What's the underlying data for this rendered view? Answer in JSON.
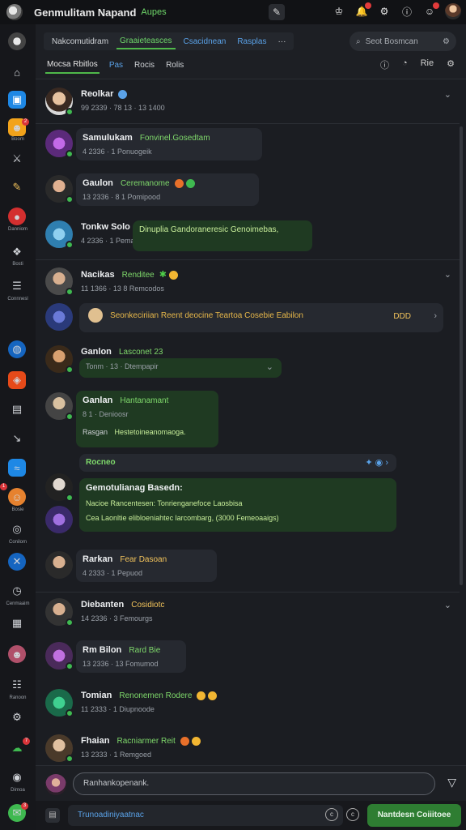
{
  "topbar": {
    "title": "Genmulitam Napand",
    "subtitle": "Aupes",
    "mid_icon": "pin-icon",
    "right_icons": [
      "bell-icon",
      "mention-icon",
      "settings-icon",
      "help-icon",
      "user-icon"
    ]
  },
  "rail": {
    "items": [
      {
        "icon": "home-icon",
        "label": ""
      },
      {
        "icon": "bookmark-icon",
        "label": ""
      },
      {
        "icon": "box-icon",
        "label": "Boom"
      },
      {
        "icon": "swords-icon",
        "label": ""
      },
      {
        "icon": "pen-icon",
        "label": ""
      },
      {
        "icon": "record-icon",
        "label": "Danniom"
      },
      {
        "icon": "cube-icon",
        "label": "Bosti"
      },
      {
        "icon": "stack-icon",
        "label": "Connnesl"
      },
      {
        "icon": "globe-icon",
        "label": ""
      },
      {
        "icon": "app-icon",
        "label": ""
      },
      {
        "icon": "tablet-icon",
        "label": ""
      },
      {
        "icon": "arrow-icon",
        "label": ""
      },
      {
        "icon": "chart-icon",
        "label": ""
      },
      {
        "icon": "face-icon",
        "label": "Bosie"
      },
      {
        "icon": "camera-icon",
        "label": "Conilom"
      },
      {
        "icon": "close-circle-icon",
        "label": ""
      },
      {
        "icon": "clock-icon",
        "label": "Cenmaaim"
      },
      {
        "icon": "frame-icon",
        "label": ""
      },
      {
        "icon": "robot-icon",
        "label": ""
      },
      {
        "icon": "list-icon",
        "label": "Ranoon"
      },
      {
        "icon": "gear-icon",
        "label": ""
      },
      {
        "icon": "cloud-icon",
        "label": ""
      },
      {
        "icon": "disc-icon",
        "label": "Dirnoa"
      },
      {
        "icon": "chat-icon",
        "label": ""
      }
    ]
  },
  "header": {
    "tabs": [
      {
        "label": "Nakcomutidram"
      },
      {
        "label": "Graaieteasces"
      },
      {
        "label": "Csacidnean"
      },
      {
        "label": "Rasplas"
      }
    ],
    "more": "···",
    "search_placeholder": "Seot Bosmcan",
    "subtabs": [
      {
        "label": "Mocsa Rbitlos"
      },
      {
        "label": "Pas"
      },
      {
        "label": "Rocis"
      },
      {
        "label": "Rolis"
      }
    ],
    "right_labels": [
      "ⓘ",
      "◔",
      "Rie",
      "⚙"
    ]
  },
  "feed": [
    {
      "name": "Reolkar",
      "status": "",
      "meta": "99 2339 · 78 13 · 13 1400"
    },
    {
      "name": "Samulukam",
      "status": "Fonvinel.Gosedtam",
      "meta": "4 2336 · 1 Ponuogeik"
    },
    {
      "name": "Gaulon",
      "status": "Ceremanome",
      "meta": "13 2336 · 8 1 Pomipood"
    },
    {
      "name": "Tonkw Solo",
      "status": "Dinuplia Gandoraneresic Genoimebas,",
      "meta": "4 2336 · 1 Pemagoed"
    },
    {
      "name": "Nacikas",
      "status": "Renditee",
      "meta": "11 1366 · 13 8 Remcodos"
    },
    {
      "name": "",
      "status": "Seonkeciriian Reent deocine Teartoa Cosebie Eabilon",
      "meta": "DDD"
    },
    {
      "name": "Ganlon",
      "status": "Lasconet 23",
      "meta": "Tonm · 13 · Dtempapir"
    },
    {
      "name": "Ganlan",
      "status": "Hantanamant",
      "meta": "8 1 · Denioosr",
      "extra_label": "Rasgan",
      "extra_text": "Hestetoineanomaoga."
    },
    {
      "name": "Rocneo",
      "status": "",
      "meta": ""
    },
    {
      "name": "Gemotulianag Basedn:",
      "status": "Nacioe Rancentesen: Tonrienganefoce Laosbisa",
      "meta": "Cea Laonltie elibloeniahtec larcombarg, (3000 Femeoaaigs)"
    },
    {
      "name": "Rarkan",
      "status": "Fear Dasoan",
      "meta": "4 2333 · 1 Pepuod"
    },
    {
      "name": "Diebanten",
      "status": "Cosidiotc",
      "meta": "14 2336 · 3 Femourgs"
    },
    {
      "name": "Rm Bilon",
      "status": "Rard Bie",
      "meta": "13 2336 · 13 Fomumod"
    },
    {
      "name": "Tomian",
      "status": "Renonemen Rodere",
      "meta": "11 2333 · 1 Diupnoode"
    },
    {
      "name": "Fhaian",
      "status": "Racniarmer Reit",
      "meta": "13 2333 · 1 Remgoed"
    }
  ],
  "composer": {
    "reply_placeholder": "Ranhankopenank.",
    "message_placeholder": "Trunoadiniyaatnac",
    "submit_label": "Nantdesn Coiiitoee"
  }
}
